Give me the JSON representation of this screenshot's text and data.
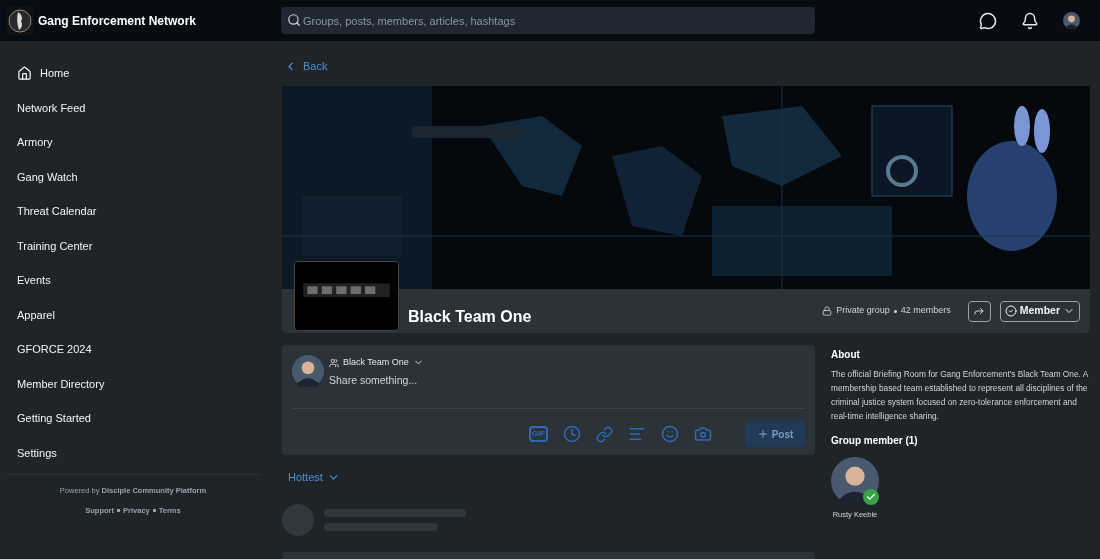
{
  "header": {
    "site_name": "Gang Enforcement Network",
    "search": {
      "placeholder": "Groups, posts, members, articles, hashtags"
    }
  },
  "sidebar": {
    "items": [
      {
        "label": "Home",
        "kind": "home"
      },
      {
        "label": "Network Feed",
        "kind": "link"
      },
      {
        "label": "Armory",
        "kind": "link"
      },
      {
        "label": "Gang Watch",
        "kind": "link"
      },
      {
        "label": "Threat Calendar",
        "kind": "link"
      },
      {
        "label": "Training Center",
        "kind": "link"
      },
      {
        "label": "Events",
        "kind": "link"
      },
      {
        "label": "Apparel",
        "kind": "link"
      },
      {
        "label": "GFORCE 2024",
        "kind": "link"
      },
      {
        "label": "Member Directory",
        "kind": "link"
      },
      {
        "label": "Getting Started",
        "kind": "link"
      },
      {
        "label": "Settings",
        "kind": "link"
      }
    ],
    "powered_by": "Powered by **Disciple Community Platform**",
    "links": [
      "Support",
      "Privacy",
      "Terms"
    ]
  },
  "back": "Back",
  "group": {
    "name": "Black Team One",
    "privacy": "Private group",
    "members": "42 members",
    "membership": "Member"
  },
  "composer": {
    "audience": "Black Team One",
    "placeholder": "Share something...",
    "gif_label": "GIF",
    "post_button": {
      "label": "Post",
      "disabled": true
    }
  },
  "sort": "Hottest",
  "about": {
    "title": "About",
    "text": "The official Briefing Room for Gang Enforcement's Black Team One. A membership based team established to represent all disciplines of the criminal justice system focused on zero-tolerance enforcement and real-time intelligence sharing."
  },
  "group_members": {
    "title": "Group member (1)",
    "people": [
      {
        "name": "Rusty Keeble",
        "verified": true
      }
    ]
  }
}
